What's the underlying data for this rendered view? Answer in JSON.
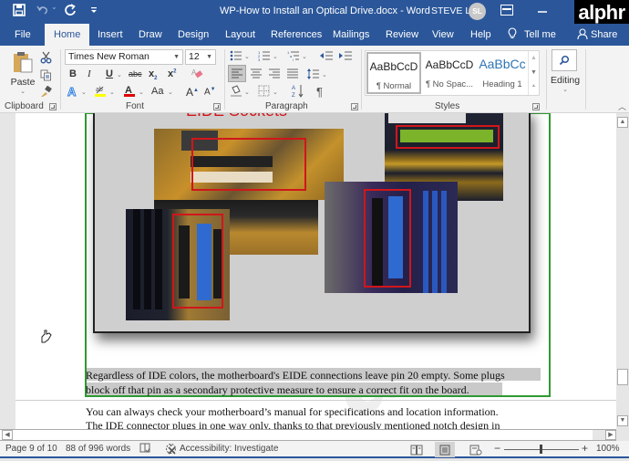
{
  "window": {
    "title": "WP-How to Install an Optical Drive.docx  -  Word",
    "user_name": "STEVE L",
    "user_initials": "SL",
    "watermark_logo": "alphr",
    "accent_color": "#2b579a"
  },
  "quick_access": {
    "save_icon": "save-icon",
    "undo_icon": "undo-icon",
    "redo_icon": "repeat-icon",
    "customize_icon": "customize-toolbar-icon"
  },
  "tabs": [
    {
      "label": "File",
      "active": false
    },
    {
      "label": "Home",
      "active": true
    },
    {
      "label": "Insert",
      "active": false
    },
    {
      "label": "Draw",
      "active": false
    },
    {
      "label": "Design",
      "active": false
    },
    {
      "label": "Layout",
      "active": false
    },
    {
      "label": "References",
      "active": false
    },
    {
      "label": "Mailings",
      "active": false
    },
    {
      "label": "Review",
      "active": false
    },
    {
      "label": "View",
      "active": false
    },
    {
      "label": "Help",
      "active": false
    }
  ],
  "tell_me": {
    "label": "Tell me"
  },
  "share": {
    "label": "Share"
  },
  "ribbon": {
    "clipboard": {
      "label": "Clipboard",
      "paste_label": "Paste"
    },
    "font": {
      "label": "Font",
      "font_name": "Times New Roman",
      "font_size": "12",
      "bold": "B",
      "italic": "I",
      "underline": "U",
      "strikethrough": "abc",
      "subscript": "x",
      "superscript": "x",
      "change_case": "Aa",
      "grow": "A",
      "shrink": "A",
      "highlight_color": "#ffff00",
      "font_color": "#e00000"
    },
    "paragraph": {
      "label": "Paragraph",
      "pilcrow": "¶"
    },
    "styles": {
      "label": "Styles",
      "items": [
        {
          "sample": "AaBbCcD",
          "name": "¶ Normal",
          "selected": true
        },
        {
          "sample": "AaBbCcD",
          "name": "¶ No Spac...",
          "selected": false
        },
        {
          "sample": "AaBbCc",
          "name": "Heading 1",
          "selected": false
        }
      ]
    },
    "editing": {
      "label": "Editing"
    }
  },
  "document": {
    "image_title_partial": "EIDE Sockets",
    "caption_line1": "Regardless of IDE colors, the motherboard's EIDE connections leave pin 20 empty. Some plugs",
    "caption_line2": "block off that pin as a secondary protective measure to ensure a correct fit on the board.",
    "body_line1": "You can always check your motherboard’s manual for specifications and location information.",
    "body_line2": "The IDE connector plugs in one way only, thanks to that previously mentioned notch design in"
  },
  "statusbar": {
    "page": "Page 9 of 10",
    "words": "88 of 996 words",
    "accessibility": "Accessibility: Investigate",
    "zoom_level": "100%",
    "zoom_minus": "−",
    "zoom_plus": "+",
    "zoom_fraction": 0.5
  }
}
